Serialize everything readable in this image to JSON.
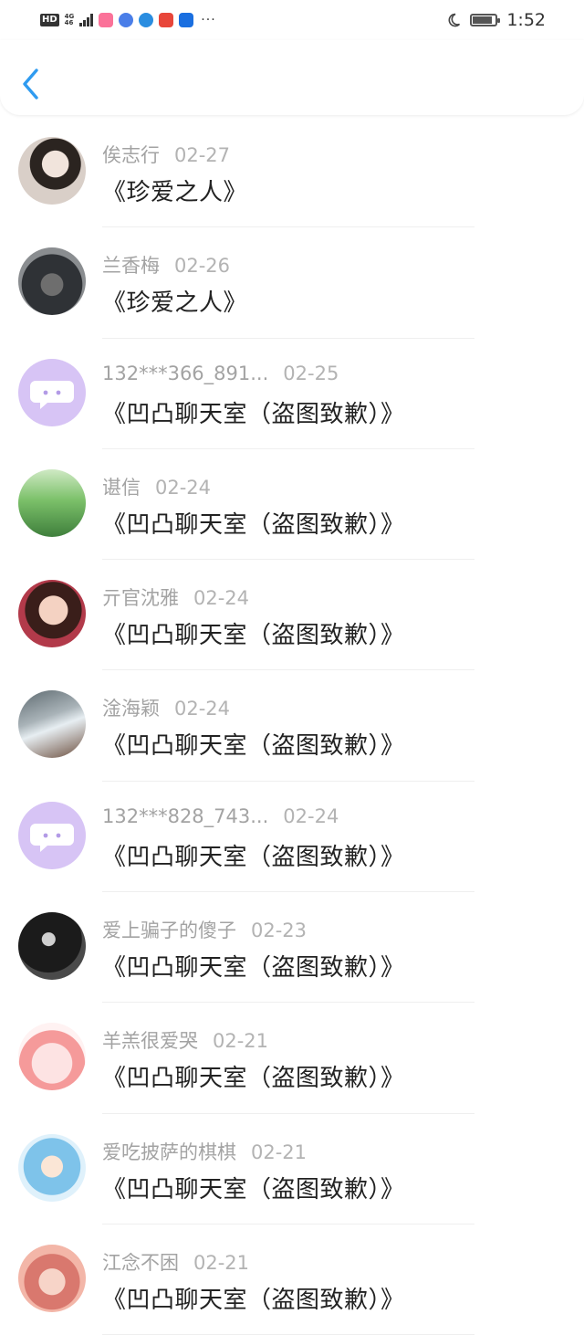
{
  "status_bar": {
    "hd": "HD",
    "net_top": "4G",
    "net_bottom": "46",
    "time": "1:52",
    "more": "···"
  },
  "header": {
    "back_icon": "chevron-left-icon"
  },
  "items": [
    {
      "name": "俟志行",
      "date": "02-27",
      "title": "《珍爱之人》",
      "avatar": "photo-girl"
    },
    {
      "name": "兰香梅",
      "date": "02-26",
      "title": "《珍爱之人》",
      "avatar": "photo-dark"
    },
    {
      "name": "132***366_891...",
      "date": "02-25",
      "title": "《凹凸聊天室（盗图致歉）》",
      "avatar": "default-chat-bubble"
    },
    {
      "name": "谌信",
      "date": "02-24",
      "title": "《凹凸聊天室（盗图致歉）》",
      "avatar": "photo-green"
    },
    {
      "name": "亓官沈雅",
      "date": "02-24",
      "title": "《凹凸聊天室（盗图致歉）》",
      "avatar": "photo-face"
    },
    {
      "name": "淦海颖",
      "date": "02-24",
      "title": "《凹凸聊天室（盗图致歉）》",
      "avatar": "photo-street"
    },
    {
      "name": "132***828_743...",
      "date": "02-24",
      "title": "《凹凸聊天室（盗图致歉）》",
      "avatar": "default-chat-bubble"
    },
    {
      "name": "爱上骗子的傻子",
      "date": "02-23",
      "title": "《凹凸聊天室（盗图致歉）》",
      "avatar": "photo-night"
    },
    {
      "name": "羊羔很爱哭",
      "date": "02-21",
      "title": "《凹凸聊天室（盗图致歉）》",
      "avatar": "cartoon-pink"
    },
    {
      "name": "爱吃披萨的棋棋",
      "date": "02-21",
      "title": "《凹凸聊天室（盗图致歉）》",
      "avatar": "anime-blue"
    },
    {
      "name": "江念不困",
      "date": "02-21",
      "title": "《凹凸聊天室（盗图致歉）》",
      "avatar": "anime-pink"
    }
  ],
  "colors": {
    "accent": "#2f9bf0",
    "name_gray": "#a3a3a3",
    "title_dark": "#222222",
    "default_avatar_bg": "#d7c4f5"
  }
}
